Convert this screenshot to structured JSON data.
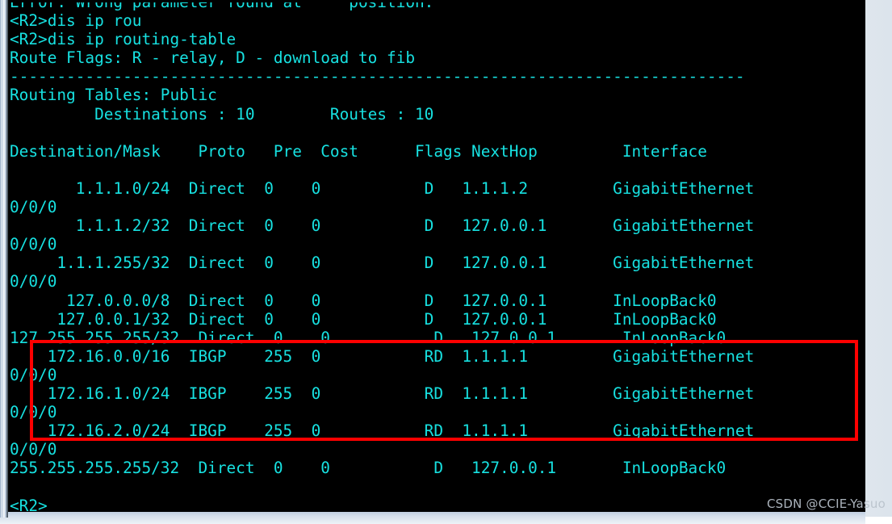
{
  "window": {
    "type": "terminal-console",
    "background_color": "#000000",
    "text_color": "#17e1e1",
    "frame_color": "#c3d2e2"
  },
  "terminal": {
    "device_prompt": "<R2>",
    "commands": [
      "dis ip rou",
      "dis ip routing-table"
    ],
    "clipped_top_line": "Error: Wrong parameter found at     position.",
    "route_flags_line": "Route Flags: R - relay, D - download to fib",
    "separator": "------------------------------------------------------------------------------",
    "routing_table_label": "Routing Tables: Public",
    "destinations_label": "Destinations",
    "destinations_count": "10",
    "routes_label": "Routes",
    "routes_count": "10",
    "columns": [
      "Destination/Mask",
      "Proto",
      "Pre",
      "Cost",
      "Flags",
      "NextHop",
      "Interface"
    ],
    "routes": [
      {
        "destination": "1.1.1.0/24",
        "proto": "Direct",
        "pre": "0",
        "cost": "0",
        "flags": "D",
        "nexthop": "1.1.1.2",
        "interface": "GigabitEthernet0/0/0",
        "highlighted": false
      },
      {
        "destination": "1.1.1.2/32",
        "proto": "Direct",
        "pre": "0",
        "cost": "0",
        "flags": "D",
        "nexthop": "127.0.0.1",
        "interface": "GigabitEthernet0/0/0",
        "highlighted": false
      },
      {
        "destination": "1.1.1.255/32",
        "proto": "Direct",
        "pre": "0",
        "cost": "0",
        "flags": "D",
        "nexthop": "127.0.0.1",
        "interface": "GigabitEthernet0/0/0",
        "highlighted": false
      },
      {
        "destination": "127.0.0.0/8",
        "proto": "Direct",
        "pre": "0",
        "cost": "0",
        "flags": "D",
        "nexthop": "127.0.0.1",
        "interface": "InLoopBack0",
        "highlighted": false
      },
      {
        "destination": "127.0.0.1/32",
        "proto": "Direct",
        "pre": "0",
        "cost": "0",
        "flags": "D",
        "nexthop": "127.0.0.1",
        "interface": "InLoopBack0",
        "highlighted": false
      },
      {
        "destination": "127.255.255.255/32",
        "proto": "Direct",
        "pre": "0",
        "cost": "0",
        "flags": "D",
        "nexthop": "127.0.0.1",
        "interface": "InLoopBack0",
        "highlighted": false
      },
      {
        "destination": "172.16.0.0/16",
        "proto": "IBGP",
        "pre": "255",
        "cost": "0",
        "flags": "RD",
        "nexthop": "1.1.1.1",
        "interface": "GigabitEthernet0/0/0",
        "highlighted": true
      },
      {
        "destination": "172.16.1.0/24",
        "proto": "IBGP",
        "pre": "255",
        "cost": "0",
        "flags": "RD",
        "nexthop": "1.1.1.1",
        "interface": "GigabitEthernet0/0/0",
        "highlighted": true
      },
      {
        "destination": "172.16.2.0/24",
        "proto": "IBGP",
        "pre": "255",
        "cost": "0",
        "flags": "RD",
        "nexthop": "1.1.1.1",
        "interface": "GigabitEthernet0/0/0",
        "highlighted": true
      },
      {
        "destination": "255.255.255.255/32",
        "proto": "Direct",
        "pre": "0",
        "cost": "0",
        "flags": "D",
        "nexthop": "127.0.0.1",
        "interface": "InLoopBack0",
        "highlighted": false
      }
    ],
    "screen_text": "Error: Wrong parameter found at     position.\n<R2>dis ip rou\n<R2>dis ip routing-table\nRoute Flags: R - relay, D - download to fib\n------------------------------------------------------------------------------\nRouting Tables: Public\n         Destinations : 10        Routes : 10\n\nDestination/Mask    Proto   Pre  Cost      Flags NextHop         Interface\n\n       1.1.1.0/24  Direct  0    0           D   1.1.1.2         GigabitEthernet\n0/0/0\n       1.1.1.2/32  Direct  0    0           D   127.0.0.1       GigabitEthernet\n0/0/0\n     1.1.1.255/32  Direct  0    0           D   127.0.0.1       GigabitEthernet\n0/0/0\n      127.0.0.0/8  Direct  0    0           D   127.0.0.1       InLoopBack0\n     127.0.0.1/32  Direct  0    0           D   127.0.0.1       InLoopBack0\n127.255.255.255/32  Direct  0    0           D   127.0.0.1       InLoopBack0\n    172.16.0.0/16  IBGP    255  0           RD  1.1.1.1         GigabitEthernet\n0/0/0\n    172.16.1.0/24  IBGP    255  0           RD  1.1.1.1         GigabitEthernet\n0/0/0\n    172.16.2.0/24  IBGP    255  0           RD  1.1.1.1         GigabitEthernet\n0/0/0\n255.255.255.255/32  Direct  0    0           D   127.0.0.1       InLoopBack0\n\n<R2>"
  },
  "annotation": {
    "highlight_color": "#fe0000",
    "highlight_label": "ibgp-routes-highlight"
  },
  "watermark": {
    "text": "CSDN @CCIE-Yasuo"
  }
}
